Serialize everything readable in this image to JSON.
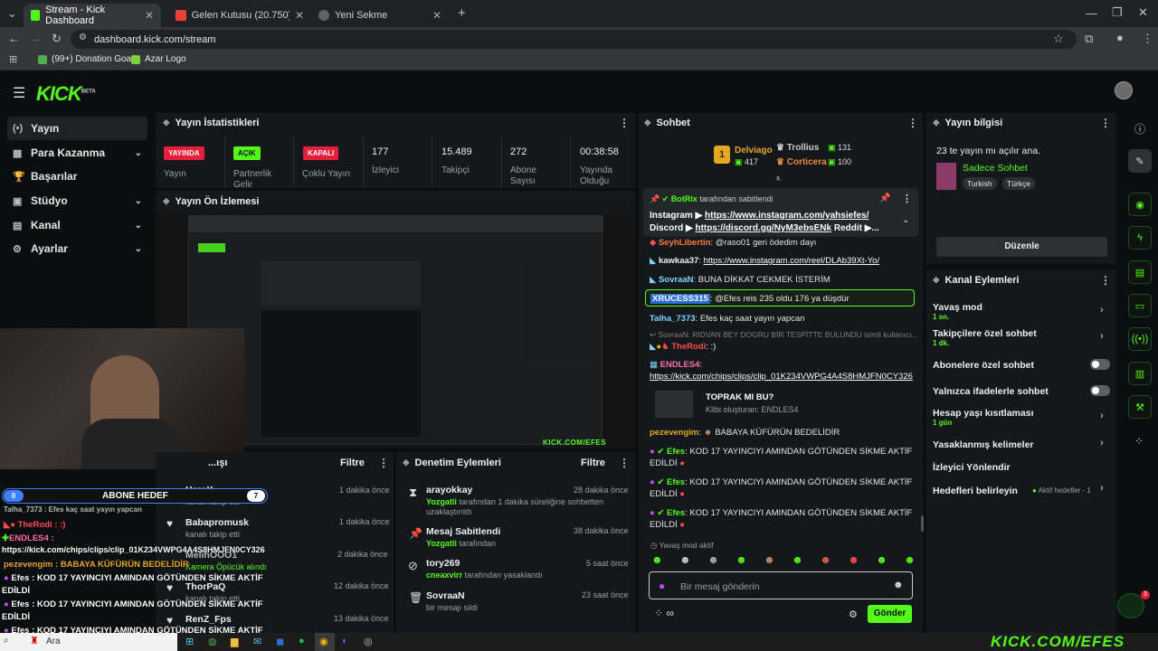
{
  "browser": {
    "tabs": [
      {
        "label": "Stream - Kick Dashboard",
        "active": true
      },
      {
        "label": "Gelen Kutusu (20.750) - senefe",
        "active": false
      },
      {
        "label": "Yeni Sekme",
        "active": false
      }
    ],
    "url": "dashboard.kick.com/stream",
    "bookmarks": [
      "(99+) Donation Goa...",
      "Azar Logo"
    ]
  },
  "header": {
    "logo": "KICK",
    "logo_sup": "BETA"
  },
  "sidebar": {
    "items": [
      {
        "label": "Yayın",
        "icon": "(•)"
      },
      {
        "label": "Para Kazanma",
        "icon": "▦"
      },
      {
        "label": "Başarılar",
        "icon": "🏆"
      },
      {
        "label": "Stüdyo",
        "icon": "▣"
      },
      {
        "label": "Kanal",
        "icon": "▤"
      },
      {
        "label": "Ayarlar",
        "icon": "⚙"
      }
    ]
  },
  "stats": {
    "title": "Yayın İstatistikleri",
    "items": [
      {
        "badge": "YAYINDA",
        "label": "Yayın"
      },
      {
        "badge": "AÇIK",
        "label": "Partnerlik Gelir"
      },
      {
        "badge": "KAPALI",
        "label": "Çoklu Yayın"
      },
      {
        "value": "177",
        "label": "İzleyici"
      },
      {
        "value": "15.489",
        "label": "Takipçi"
      },
      {
        "value": "272",
        "label": "Abone Sayısı"
      },
      {
        "value": "00:38:58",
        "label": "Yayında Olduğu"
      }
    ]
  },
  "preview": {
    "title": "Yayın Ön İzlemesi",
    "watermark": "KICK.COM/EFES"
  },
  "followers_panel": {
    "title": "...ışı",
    "filter": "Filtre",
    "items": [
      {
        "name": "HeraY",
        "desc": "kanalı takip etti",
        "time": "1 dakika önce"
      },
      {
        "name": "Babapromusk",
        "desc": "kanalı takip etti",
        "time": "1 dakika önce"
      },
      {
        "name": "MelihOOO1",
        "desc": "Kamera Öpücük alındı",
        "time": "2 dakika önce"
      },
      {
        "name": "ThorPaQ",
        "desc": "kanalı takip etti",
        "time": "12 dakika önce"
      },
      {
        "name": "RenZ_Fps",
        "desc": "",
        "time": "13 dakika önce"
      }
    ]
  },
  "moderation": {
    "title": "Denetim Eylemleri",
    "filter": "Filtre",
    "items": [
      {
        "name": "arayokkay",
        "by": "Yozgatli",
        "desc": "tarafından 1 dakika süreliğine sohbetten uzaklaştırıldı",
        "time": "28 dakika önce"
      },
      {
        "name": "Mesaj Sabitlendi",
        "by": "Yozgatli",
        "desc": "tarafından",
        "time": "38 dakika önce"
      },
      {
        "name": "tory269",
        "by": "cneaxvirr",
        "desc": "tarafından yasaklandı",
        "time": "5 saat önce"
      },
      {
        "name": "SovraaN",
        "by": "",
        "desc": "bir mesajı sildi",
        "time": "23 saat önce"
      }
    ]
  },
  "chat": {
    "title": "Sohbet",
    "leaders": [
      {
        "rank": "1",
        "name": "Delviago",
        "points": "417"
      },
      {
        "name": "Trollius",
        "points": "131"
      },
      {
        "name": "Corticera",
        "points": "100"
      }
    ],
    "pinned": {
      "by": "BotRix",
      "by_suffix": "tarafından sabitlendi",
      "line1_prefix": "Instagram ▶ ",
      "line1_link": "https://www.instagram.com/yahsiefes/",
      "line2_prefix": "Discord ▶ ",
      "line2_link": "https://discord.gg/NyM3ebsENk",
      "line2_suffix": " Reddit ▶..."
    },
    "messages": [
      {
        "user": "SeyhLibertin",
        "text": "@raso01 geri ödedim dayı"
      },
      {
        "user": "kawkaa37",
        "text": "https://www.instagram.com/reel/DLAb39Xt-Yo/"
      },
      {
        "user": "SovraaN",
        "text": "BUNA DİKKAT CEKMEK İSTERİM"
      },
      {
        "user": "XRUCESS315",
        "text": "@Efes reis 235 oldu 176 ya düşdür"
      },
      {
        "user": "Talha_7373",
        "text": "Efes kaç saat yayın yapcan"
      },
      {
        "user": "",
        "text": "SovraaN: RIDVAN BEY DOGRU BİR TESPİTTE BULUNDU isimli kullanıcı..."
      },
      {
        "user": "TheRodi",
        "text": ": :)"
      },
      {
        "user": "ENDLES4",
        "text": ":"
      },
      {
        "user": "",
        "text": "https://kick.com/chips/clips/clip_01K234VWPG4A4S8HMJFN0CY326"
      },
      {
        "user": "",
        "text": "TOPRAK MI BU?"
      },
      {
        "user": "",
        "text": "Klibi oluşturan: ENDLES4"
      },
      {
        "user": "pezevengim",
        "text": "BABAYA KÜFÜRÜN BEDELİDİR"
      },
      {
        "user": "Efes",
        "text": "KOD 17 YAYINCIYI AMINDAN GÖTÜNDEN SİKME AKTİF EDİLDİ"
      },
      {
        "user": "Efes",
        "text": "KOD 17 YAYINCIYI AMINDAN GÖTÜNDEN SİKME AKTİF EDİLDİ"
      },
      {
        "user": "Efes",
        "text": "KOD 17 YAYINCIYI AMINDAN GÖTÜNDEN SİKME AKTİF EDİLDİ"
      }
    ],
    "slow_mode": "Yavaş mod aktif",
    "input_placeholder": "Bir mesaj gönderin",
    "send": "Gönder"
  },
  "stream_info": {
    "title": "Yayın bilgisi",
    "stream_title": "23 te yayın mı açılır ana.",
    "category": "Sadece Sohbet",
    "tags": [
      "Turkish",
      "Türkçe"
    ],
    "edit": "Düzenle"
  },
  "channel_actions": {
    "title": "Kanal Eylemleri",
    "items": [
      {
        "label": "Yavaş mod",
        "sub": "1 sn.",
        "control": "chevron"
      },
      {
        "label": "Takipçilere özel sohbet",
        "sub": "1 dk.",
        "control": "chevron"
      },
      {
        "label": "Abonelere özel sohbet",
        "sub": "",
        "control": "toggle"
      },
      {
        "label": "Yalnızca ifadelerle sohbet",
        "sub": "",
        "control": "toggle"
      },
      {
        "label": "Hesap yaşı kısıtlaması",
        "sub": "1 gün",
        "control": "chevron"
      },
      {
        "label": "Yasaklanmış kelimeler",
        "sub": "",
        "control": "chevron"
      },
      {
        "label": "İzleyici Yönlendir",
        "sub": "",
        "control": "none"
      },
      {
        "label": "Hedefleri belirleyin",
        "sub": "Aktif hedefler - 1",
        "control": "chevron"
      }
    ]
  },
  "overlay": {
    "sub_goal_label": "ABONE HEDEF",
    "sub_goal_current": "0",
    "sub_goal_target": "7",
    "chat": [
      "Talha_7373 : Efes kaç saat yayın yapcan",
      "TheRodi : :)",
      "ENDLES4 :",
      "https://kick.com/chips/clips/clip_01K234VWPG4A4S8HMJFN0CY326",
      "pezevengim : BABAYA KÜFÜRÜN BEDELİDİR",
      "Efes : KOD 17 YAYINCIYI AMINDAN GÖTÜNDEN SİKME AKTİF",
      "EDİLDİ",
      "Efes : KOD 17 YAYINCIYI AMINDAN GÖTÜNDEN SİKME AKTİF",
      "EDİLDİ",
      "Efes : KOD 17 YAYINCIYI AMINDAN GÖTÜNDEN SİKME AKTİF",
      "EDİLDİ"
    ],
    "watermark": "KICK.COM/EFES"
  },
  "taskbar": {
    "search": "Ara"
  },
  "colors": {
    "accent": "#53fc18",
    "live": "#e91e3a",
    "bg": "#0b0e0f",
    "panel": "#14181a"
  }
}
